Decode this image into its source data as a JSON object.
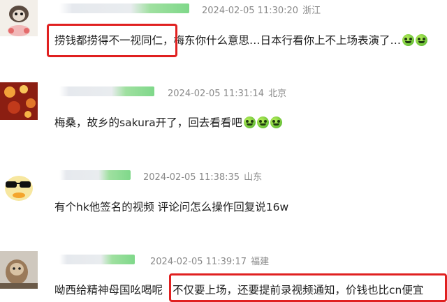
{
  "comments": [
    {
      "time": "2024-02-05 11:30:20",
      "location": "浙江",
      "text": "捞钱都捞得不一视同仁，梅东你什么意思…日本行看你上不上场表演了…",
      "emoji_count": 2,
      "highlight": "捞钱都捞得不一视同仁，"
    },
    {
      "time": "2024-02-05 11:31:14",
      "location": "北京",
      "text": "梅桑，故乡的sakura开了，回去看看吧",
      "emoji_count": 3
    },
    {
      "time": "2024-02-05 11:38:35",
      "location": "山东",
      "text": "有个hk他签名的视频 评论问怎么操作回复说16w",
      "emoji_count": 0
    },
    {
      "time": "2024-02-05 11:39:17",
      "location": "福建",
      "text_before": "呦西给精神母国吆喝呢",
      "highlight": "不仅要上场，还要提前录视频通知，价钱也比cn便宜",
      "emoji_count": 0
    }
  ],
  "colors": {
    "highlight_border": "#e02020",
    "meta_text": "#8a8a8a",
    "emoji_green": "#6cc33a"
  }
}
